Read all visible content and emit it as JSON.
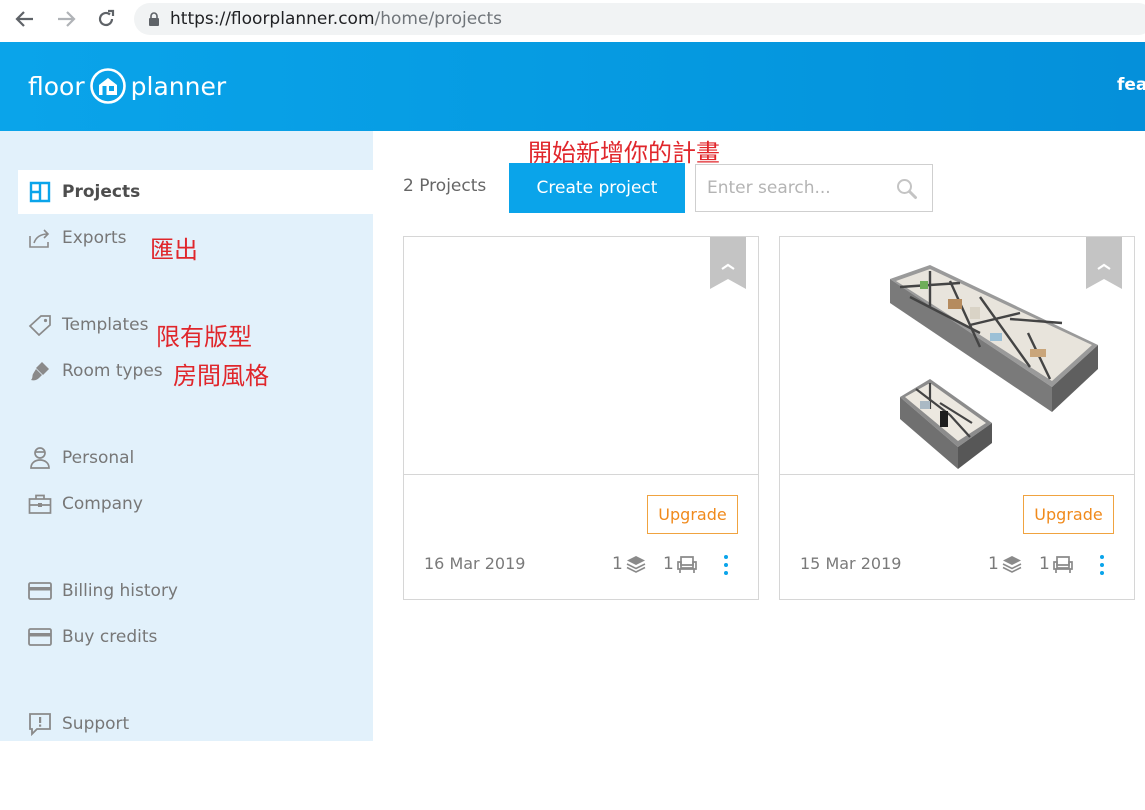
{
  "browser": {
    "url_host": "https://floorplanner.com",
    "url_path": "/home/projects"
  },
  "header": {
    "logo_left": "floor",
    "logo_right": "planner",
    "user": "fea"
  },
  "sidebar": {
    "items": [
      {
        "label": "Projects",
        "icon": "projects-icon",
        "active": true
      },
      {
        "label": "Exports",
        "icon": "exports-icon"
      },
      {
        "label": "Templates",
        "icon": "tag-icon"
      },
      {
        "label": "Room types",
        "icon": "brush-icon"
      },
      {
        "label": "Personal",
        "icon": "user-icon"
      },
      {
        "label": "Company",
        "icon": "briefcase-icon"
      },
      {
        "label": "Billing history",
        "icon": "card-icon"
      },
      {
        "label": "Buy credits",
        "icon": "card-icon"
      },
      {
        "label": "Support",
        "icon": "support-icon"
      }
    ]
  },
  "annotations": {
    "create": "開始新增你的計畫",
    "exports": "匯出",
    "templates": "限有版型",
    "room_types": "房間風格"
  },
  "toolbar": {
    "count": "2 Projects",
    "create_label": "Create project",
    "search_placeholder": "Enter search..."
  },
  "projects": [
    {
      "date": "16 Mar 2019",
      "floors": "1",
      "items": "1",
      "upgrade_label": "Upgrade",
      "has_thumbnail": false
    },
    {
      "date": "15 Mar 2019",
      "floors": "1",
      "items": "1",
      "upgrade_label": "Upgrade",
      "has_thumbnail": true
    }
  ],
  "colors": {
    "accent": "#0aa4ea",
    "sidebar_bg": "#e2f1fb",
    "upgrade": "#f08a1c",
    "annotation": "#e0262b"
  }
}
